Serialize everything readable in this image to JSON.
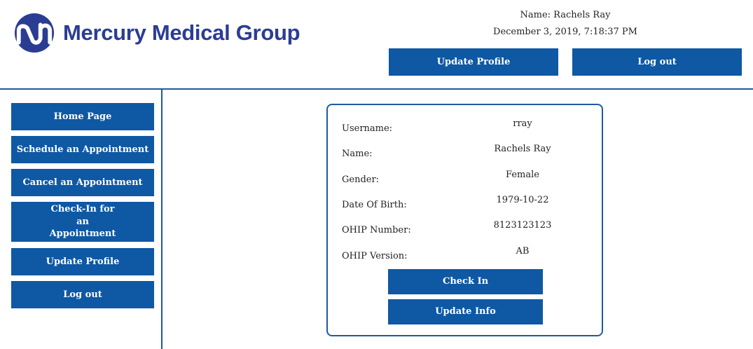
{
  "brand": {
    "name": "Mercury Medical Group",
    "logo_icon": "mercury-logo-icon",
    "color": "#2b3d93"
  },
  "header": {
    "user_name": "Name: Rachels Ray",
    "datetime": "December 3, 2019, 7:18:37 PM",
    "update_profile_label": "Update Profile",
    "logout_label": "Log out"
  },
  "sidebar": {
    "items": [
      {
        "label": "Home Page"
      },
      {
        "label": "Schedule an Appointment"
      },
      {
        "label": "Cancel an Appointment"
      },
      {
        "label": "Check-In for an Appointment"
      },
      {
        "label": "Update Profile"
      },
      {
        "label": "Log out"
      }
    ]
  },
  "profile": {
    "fields": [
      {
        "label": "Username:",
        "value": "rray"
      },
      {
        "label": "Name:",
        "value": "Rachels Ray"
      },
      {
        "label": "Gender:",
        "value": "Female"
      },
      {
        "label": "Date Of Birth:",
        "value": "1979-10-22"
      },
      {
        "label": "OHIP Number:",
        "value": "8123123123"
      },
      {
        "label": "OHIP Version:",
        "value": "AB"
      }
    ],
    "check_in_label": "Check In",
    "update_info_label": "Update Info"
  },
  "colors": {
    "button": "#0e58a4",
    "border": "#1f5a9e",
    "background": "#ffffff"
  }
}
